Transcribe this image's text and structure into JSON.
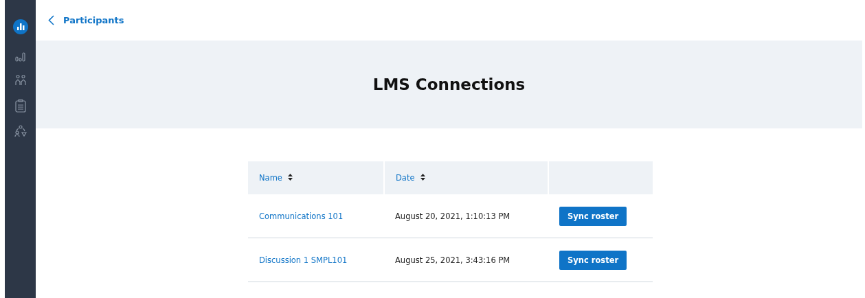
{
  "back_link": {
    "label": "Participants"
  },
  "banner": {
    "title": "LMS Connections"
  },
  "table": {
    "columns": [
      {
        "label": "Name",
        "sortable": true
      },
      {
        "label": "Date",
        "sortable": true
      },
      {
        "sortable": false
      }
    ],
    "rows": [
      {
        "name": "Communications 101",
        "date": "August 20, 2021, 1:10:13 PM",
        "action": "Sync roster"
      },
      {
        "name": "Discussion 1 SMPL101",
        "date": "August 25, 2021, 3:43:16 PM",
        "action": "Sync roster"
      }
    ]
  }
}
